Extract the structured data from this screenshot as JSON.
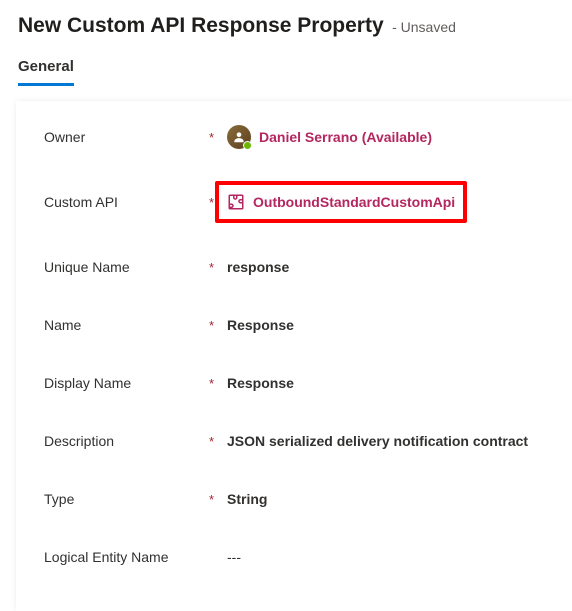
{
  "header": {
    "title": "New Custom API Response Property",
    "status": "- Unsaved"
  },
  "tabs": {
    "general": "General"
  },
  "fields": {
    "owner": {
      "label": "Owner",
      "required": "*",
      "value": "Daniel Serrano (Available)"
    },
    "custom_api": {
      "label": "Custom API",
      "required": "*",
      "value": "OutboundStandardCustomApi"
    },
    "unique_name": {
      "label": "Unique Name",
      "required": "*",
      "value": "response"
    },
    "name": {
      "label": "Name",
      "required": "*",
      "value": "Response"
    },
    "display_name": {
      "label": "Display Name",
      "required": "*",
      "value": "Response"
    },
    "description": {
      "label": "Description",
      "required": "*",
      "value": "JSON serialized delivery notification contract"
    },
    "type": {
      "label": "Type",
      "required": "*",
      "value": "String"
    },
    "logical_entity_name": {
      "label": "Logical Entity Name",
      "required": "",
      "value": "---"
    }
  }
}
